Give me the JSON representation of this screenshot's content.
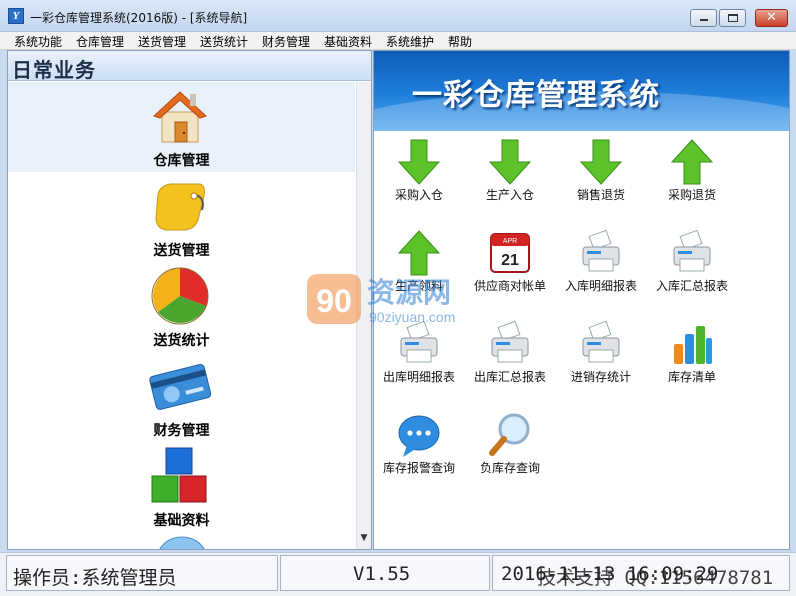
{
  "window": {
    "title": "一彩仓库管理系统(2016版) - [系统导航]",
    "app_icon_letter": "Y",
    "close_glyph": "✕"
  },
  "menu": [
    "系统功能",
    "仓库管理",
    "送货管理",
    "送货统计",
    "财务管理",
    "基础资料",
    "系统维护",
    "帮助"
  ],
  "left_panel": {
    "header": "日常业务",
    "items": [
      {
        "label": "仓库管理",
        "icon": "house-icon",
        "selected": true
      },
      {
        "label": "送货管理",
        "icon": "tag-icon",
        "selected": false
      },
      {
        "label": "送货统计",
        "icon": "pie-chart-icon",
        "selected": false
      },
      {
        "label": "财务管理",
        "icon": "credit-card-icon",
        "selected": false
      },
      {
        "label": "基础资料",
        "icon": "blocks-icon",
        "selected": false
      }
    ],
    "scroll_down_glyph": "▼"
  },
  "banner": {
    "title": "一彩仓库管理系统"
  },
  "tiles": [
    {
      "label": "采购入仓",
      "icon": "arrow-down-icon"
    },
    {
      "label": "生产入仓",
      "icon": "arrow-down-icon"
    },
    {
      "label": "销售退货",
      "icon": "arrow-down-icon"
    },
    {
      "label": "采购退货",
      "icon": "arrow-up-icon"
    },
    {
      "label": "生产领料",
      "icon": "arrow-up-icon"
    },
    {
      "label": "供应商对帐单",
      "icon": "calendar-icon"
    },
    {
      "label": "入库明细报表",
      "icon": "printer-icon"
    },
    {
      "label": "入库汇总报表",
      "icon": "printer-icon"
    },
    {
      "label": "出库明细报表",
      "icon": "printer-icon"
    },
    {
      "label": "出库汇总报表",
      "icon": "printer-icon"
    },
    {
      "label": "进销存统计",
      "icon": "printer-icon"
    },
    {
      "label": "库存清单",
      "icon": "bar-chart-icon"
    },
    {
      "label": "库存报警查询",
      "icon": "chat-bubble-icon"
    },
    {
      "label": "负库存查询",
      "icon": "magnifier-icon"
    }
  ],
  "calendar_icon": {
    "month": "APR",
    "day": "21"
  },
  "watermark": {
    "brand": "资源网",
    "url": "90ziyuan.com",
    "logo_text": "90"
  },
  "status": {
    "operator": "操作员:系统管理员",
    "version": "V1.55",
    "date": "2016-11-13 16:09:29",
    "support": "技术支持 QQ:1156478781"
  },
  "colors": {
    "banner": "#1f7fdb",
    "arrow_green": "#5cc22a",
    "watermark_orange": "#f08a3a"
  }
}
